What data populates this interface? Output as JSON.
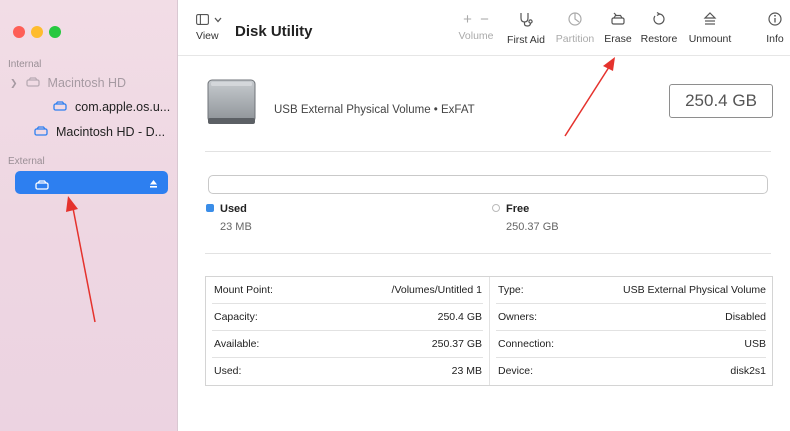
{
  "window": {
    "traffic_colors": [
      "#fe5f57",
      "#febc2e",
      "#28c840"
    ]
  },
  "sidebar": {
    "section_internal": "Internal",
    "section_external": "External",
    "items": [
      {
        "label": "Macintosh HD"
      },
      {
        "label": "com.apple.os.u..."
      },
      {
        "label": "Macintosh HD - D..."
      }
    ],
    "selected_color": "#2d7ff0"
  },
  "toolbar": {
    "view_label": "View",
    "title": "Disk Utility",
    "volume_label": "Volume",
    "first_aid_label": "First Aid",
    "partition_label": "Partition",
    "erase_label": "Erase",
    "restore_label": "Restore",
    "unmount_label": "Unmount",
    "info_label": "Info"
  },
  "volume": {
    "description": "USB External Physical Volume • ExFAT",
    "size": "250.4 GB"
  },
  "usage": {
    "used_label": "Used",
    "used_value": "23 MB",
    "used_color": "#3a8de8",
    "free_label": "Free",
    "free_value": "250.37 GB"
  },
  "info_table": {
    "left": [
      {
        "key": "Mount Point:",
        "value": "/Volumes/Untitled 1"
      },
      {
        "key": "Capacity:",
        "value": "250.4 GB"
      },
      {
        "key": "Available:",
        "value": "250.37 GB"
      },
      {
        "key": "Used:",
        "value": "23 MB"
      }
    ],
    "right": [
      {
        "key": "Type:",
        "value": "USB External Physical Volume"
      },
      {
        "key": "Owners:",
        "value": "Disabled"
      },
      {
        "key": "Connection:",
        "value": "USB"
      },
      {
        "key": "Device:",
        "value": "disk2s1"
      }
    ]
  },
  "annotations": {
    "arrow_color": "#e5322d"
  }
}
